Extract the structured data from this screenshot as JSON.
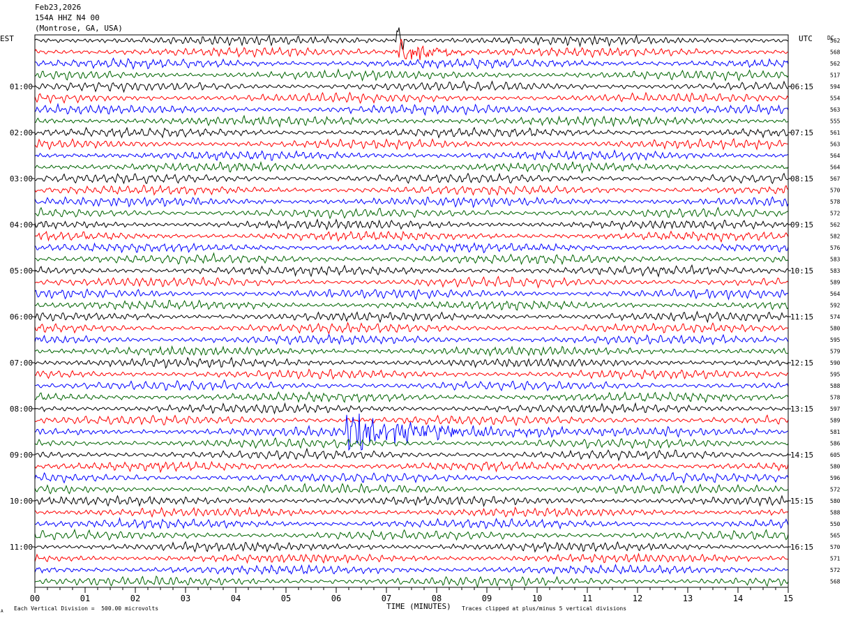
{
  "header": {
    "date": "Feb23,2026",
    "station": "154A HHZ N4 00",
    "location": "(Montrose, GA, USA)"
  },
  "labels": {
    "left_tz": "EST",
    "right_tz": "UTC",
    "dc": "DC",
    "xaxis": "TIME (MINUTES)",
    "division_note": "Each Vertical Division =  500.00 microvolts",
    "clip_note": "Traces clipped at plus/minus 5 vertical divisions",
    "corner_mark": "A"
  },
  "colors": {
    "black": "#000000",
    "red": "#ff0000",
    "blue": "#0000ff",
    "green": "#006400"
  },
  "chart_data": {
    "type": "line",
    "xlim": [
      0,
      15
    ],
    "x_ticks": [
      "00",
      "01",
      "02",
      "03",
      "04",
      "05",
      "06",
      "07",
      "08",
      "09",
      "10",
      "11",
      "12",
      "13",
      "14",
      "15"
    ],
    "left_time_labels": [
      "01:00",
      "02:00",
      "03:00",
      "04:00",
      "05:00",
      "06:00",
      "07:00",
      "08:00",
      "09:00",
      "10:00",
      "11:00"
    ],
    "right_time_labels": [
      "06:15",
      "07:15",
      "08:15",
      "09:15",
      "10:15",
      "11:15",
      "12:15",
      "13:15",
      "14:15",
      "15:15",
      "16:15"
    ],
    "label_every_traces": 4,
    "first_label_trace": 4,
    "trace_color_cycle": [
      "#000000",
      "#ff0000",
      "#0000ff",
      "#006400"
    ],
    "dc_offsets": [
      "562",
      "568",
      "562",
      "517",
      "594",
      "554",
      "563",
      "555",
      "561",
      "563",
      "564",
      "564",
      "567",
      "570",
      "578",
      "572",
      "562",
      "582",
      "576",
      "583",
      "583",
      "589",
      "564",
      "592",
      "574",
      "580",
      "595",
      "579",
      "590",
      "595",
      "588",
      "578",
      "597",
      "589",
      "581",
      "586",
      "605",
      "580",
      "596",
      "572",
      "580",
      "588",
      "550",
      "565",
      "570",
      "571",
      "572",
      "568"
    ],
    "events": [
      {
        "trace": 0,
        "minute_start": 7.2,
        "minute_end": 7.35,
        "type": "spike"
      },
      {
        "trace": 1,
        "minute_start": 7.2,
        "minute_end": 8.6,
        "type": "burst"
      },
      {
        "trace": 34,
        "minute_start": 6.2,
        "minute_end": 10.5,
        "type": "burst"
      }
    ]
  }
}
